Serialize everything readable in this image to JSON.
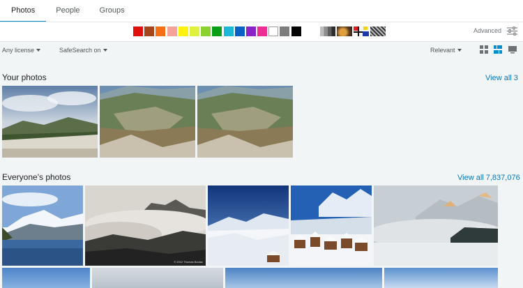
{
  "tabs": [
    "Photos",
    "People",
    "Groups"
  ],
  "color_swatches": [
    "#e0110a",
    "#a5451c",
    "#f56f14",
    "#f4a29a",
    "#fff20e",
    "#dff13b",
    "#8cd22e",
    "#0a9e14",
    "#1db8d8",
    "#0a60c2",
    "#8a24c6",
    "#ec2d94",
    "#ffffff",
    "#7d7d7d",
    "#050505"
  ],
  "style_icons": [
    "black-and-white-icon",
    "depth-of-field-icon",
    "minimalist-icon",
    "patterns-icon"
  ],
  "advanced": {
    "label": "Advanced",
    "icon": "sliders-icon"
  },
  "filters": {
    "license": "Any license",
    "safesearch": "SafeSearch on",
    "sort": "Relevant"
  },
  "view_modes": [
    "grid-small-icon",
    "grid-justified-icon",
    "slideshow-icon"
  ],
  "your_photos": {
    "title": "Your photos",
    "view_all": "View all 3"
  },
  "everyone_photos": {
    "title": "Everyone's photos",
    "view_all": "View all 7,837,076"
  },
  "watermarks": [
    "© 2012 Thomas Boulac",
    "Thomas Boulac"
  ],
  "accent_color": "#008ecf"
}
